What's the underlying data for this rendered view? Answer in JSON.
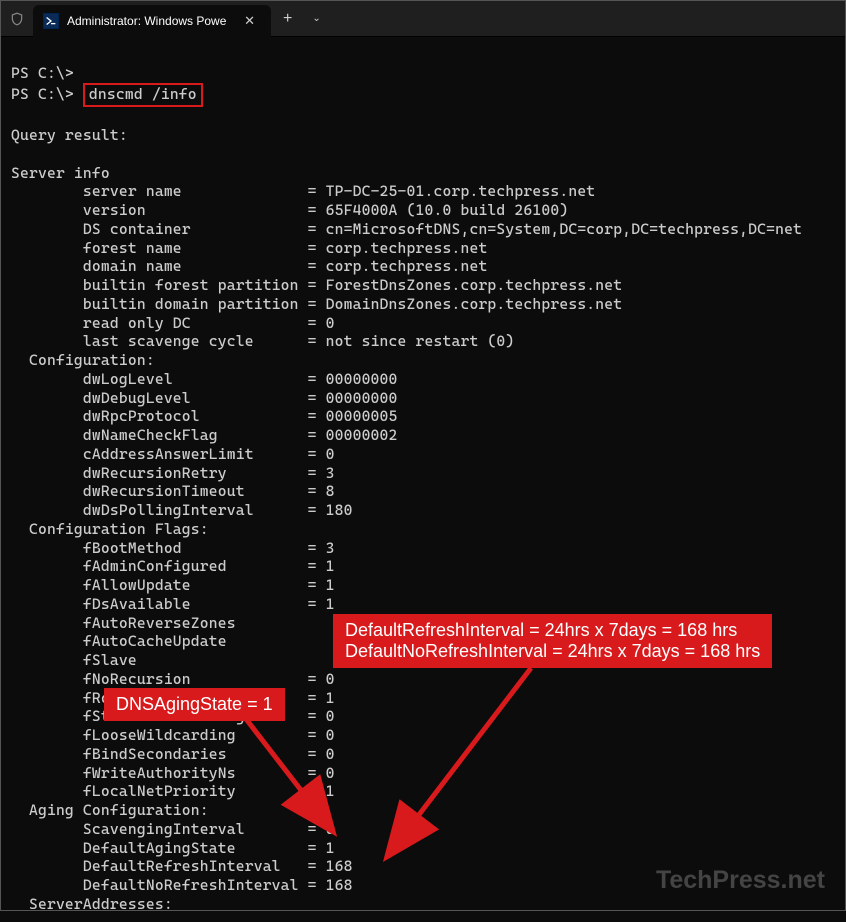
{
  "titlebar": {
    "tab_title": "Administrator: Windows Powe"
  },
  "terminal": {
    "prompt1": "PS C:\\>",
    "prompt2": "PS C:\\> ",
    "command": "dnscmd /info",
    "query_result": "Query result:",
    "server_info_header": "Server info",
    "server_info": {
      "server_name_k": "        server name              = ",
      "server_name_v": "TP-DC-25-01.corp.techpress.net",
      "version_k": "        version                  = ",
      "version_v": "65F4000A (10.0 build 26100)",
      "ds_container_k": "        DS container             = ",
      "ds_container_v": "cn=MicrosoftDNS,cn=System,DC=corp,DC=techpress,DC=net",
      "forest_name_k": "        forest name              = ",
      "forest_name_v": "corp.techpress.net",
      "domain_name_k": "        domain name              = ",
      "domain_name_v": "corp.techpress.net",
      "builtin_forest_k": "        builtin forest partition = ",
      "builtin_forest_v": "ForestDnsZones.corp.techpress.net",
      "builtin_domain_k": "        builtin domain partition = ",
      "builtin_domain_v": "DomainDnsZones.corp.techpress.net",
      "read_only_dc_k": "        read only DC             = ",
      "read_only_dc_v": "0",
      "last_scavenge_k": "        last scavenge cycle      = ",
      "last_scavenge_v": "not since restart (0)"
    },
    "configuration_header": "  Configuration:",
    "configuration": {
      "dwLogLevel": "        dwLogLevel               = 00000000",
      "dwDebugLevel": "        dwDebugLevel             = 00000000",
      "dwRpcProtocol": "        dwRpcProtocol            = 00000005",
      "dwNameCheckFlag": "        dwNameCheckFlag          = 00000002",
      "cAddressAnswerLimit": "        cAddressAnswerLimit      = 0",
      "dwRecursionRetry": "        dwRecursionRetry         = 3",
      "dwRecursionTimeout": "        dwRecursionTimeout       = 8",
      "dwDsPollingInterval": "        dwDsPollingInterval      = 180"
    },
    "config_flags_header": "  Configuration Flags:",
    "config_flags": {
      "fBootMethod": "        fBootMethod              = 3",
      "fAdminConfigured": "        fAdminConfigured         = 1",
      "fAllowUpdate": "        fAllowUpdate             = 1",
      "fDsAvailable": "        fDsAvailable             = 1",
      "fAutoReverseZones": "        fAutoReverseZones",
      "fAutoCacheUpdate": "        fAutoCacheUpdate",
      "fSlave": "        fSlave",
      "fNoRecursion": "        fNoRecursion             = 0",
      "fRoundRobin": "        fRoundRobin              = 1",
      "fStrictFileParsing": "        fStrictFileParsing       = 0",
      "fLooseWildcarding": "        fLooseWildcarding        = 0",
      "fBindSecondaries": "        fBindSecondaries         = 0",
      "fWriteAuthorityNs": "        fWriteAuthorityNs        = 0",
      "fLocalNetPriority": "        fLocalNetPriority        = 1"
    },
    "aging_header": "  Aging Configuration:",
    "aging": {
      "ScavengingInterval": "        ScavengingInterval       = 0",
      "DefaultAgingState": "        DefaultAgingState        = 1",
      "DefaultRefreshInterval": "        DefaultRefreshInterval   = 168",
      "DefaultNoRefreshInterval": "        DefaultNoRefreshInterval = 168"
    },
    "server_addresses_header": "  ServerAddresses:"
  },
  "annotations": {
    "aging_state": "DNSAgingState = 1",
    "refresh_line1": "DefaultRefreshInterval = 24hrs x 7days = 168 hrs",
    "refresh_line2": "DefaultNoRefreshInterval = 24hrs x 7days = 168 hrs"
  },
  "watermark": "TechPress.net"
}
